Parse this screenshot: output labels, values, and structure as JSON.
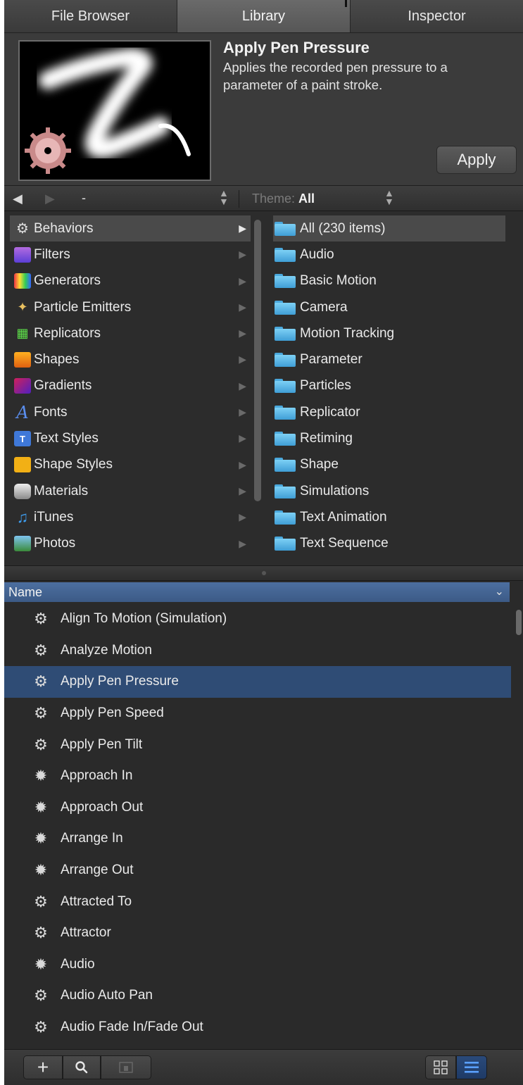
{
  "tabs": [
    {
      "label": "File Browser"
    },
    {
      "label": "Library"
    },
    {
      "label": "Inspector"
    }
  ],
  "preview": {
    "title": "Apply Pen Pressure",
    "description": "Applies the recorded pen pressure to a parameter of a paint stroke.",
    "apply_label": "Apply"
  },
  "nav": {
    "path": "-",
    "theme_label": "Theme:",
    "theme_value": "All"
  },
  "categories": [
    {
      "label": "Behaviors",
      "icon": "gear-icon",
      "selected": true
    },
    {
      "label": "Filters",
      "icon": "filters-icon"
    },
    {
      "label": "Generators",
      "icon": "generators-icon"
    },
    {
      "label": "Particle Emitters",
      "icon": "particle-emitters-icon"
    },
    {
      "label": "Replicators",
      "icon": "replicators-icon"
    },
    {
      "label": "Shapes",
      "icon": "shapes-icon"
    },
    {
      "label": "Gradients",
      "icon": "gradients-icon"
    },
    {
      "label": "Fonts",
      "icon": "fonts-icon"
    },
    {
      "label": "Text Styles",
      "icon": "text-styles-icon"
    },
    {
      "label": "Shape Styles",
      "icon": "shape-styles-icon"
    },
    {
      "label": "Materials",
      "icon": "materials-icon"
    },
    {
      "label": "iTunes",
      "icon": "music-note-icon"
    },
    {
      "label": "Photos",
      "icon": "photos-icon"
    }
  ],
  "subcategories": [
    {
      "label": "All (230 items)",
      "selected": true
    },
    {
      "label": "Audio"
    },
    {
      "label": "Basic Motion"
    },
    {
      "label": "Camera"
    },
    {
      "label": "Motion Tracking"
    },
    {
      "label": "Parameter"
    },
    {
      "label": "Particles"
    },
    {
      "label": "Replicator"
    },
    {
      "label": "Retiming"
    },
    {
      "label": "Shape"
    },
    {
      "label": "Simulations"
    },
    {
      "label": "Text Animation"
    },
    {
      "label": "Text Sequence"
    }
  ],
  "list_header": "Name",
  "items": [
    {
      "label": "Align To Motion (Simulation)"
    },
    {
      "label": "Analyze Motion"
    },
    {
      "label": "Apply Pen Pressure",
      "selected": true
    },
    {
      "label": "Apply Pen Speed"
    },
    {
      "label": "Apply Pen Tilt"
    },
    {
      "label": "Approach In"
    },
    {
      "label": "Approach Out"
    },
    {
      "label": "Arrange In"
    },
    {
      "label": "Arrange Out"
    },
    {
      "label": "Attracted To"
    },
    {
      "label": "Attractor"
    },
    {
      "label": "Audio"
    },
    {
      "label": "Audio Auto Pan"
    },
    {
      "label": "Audio Fade In/Fade Out"
    }
  ],
  "colors": {
    "selection": "#2f4c75",
    "header_blue": "#4c6fa0",
    "folder_blue": "#4aa8dc"
  }
}
